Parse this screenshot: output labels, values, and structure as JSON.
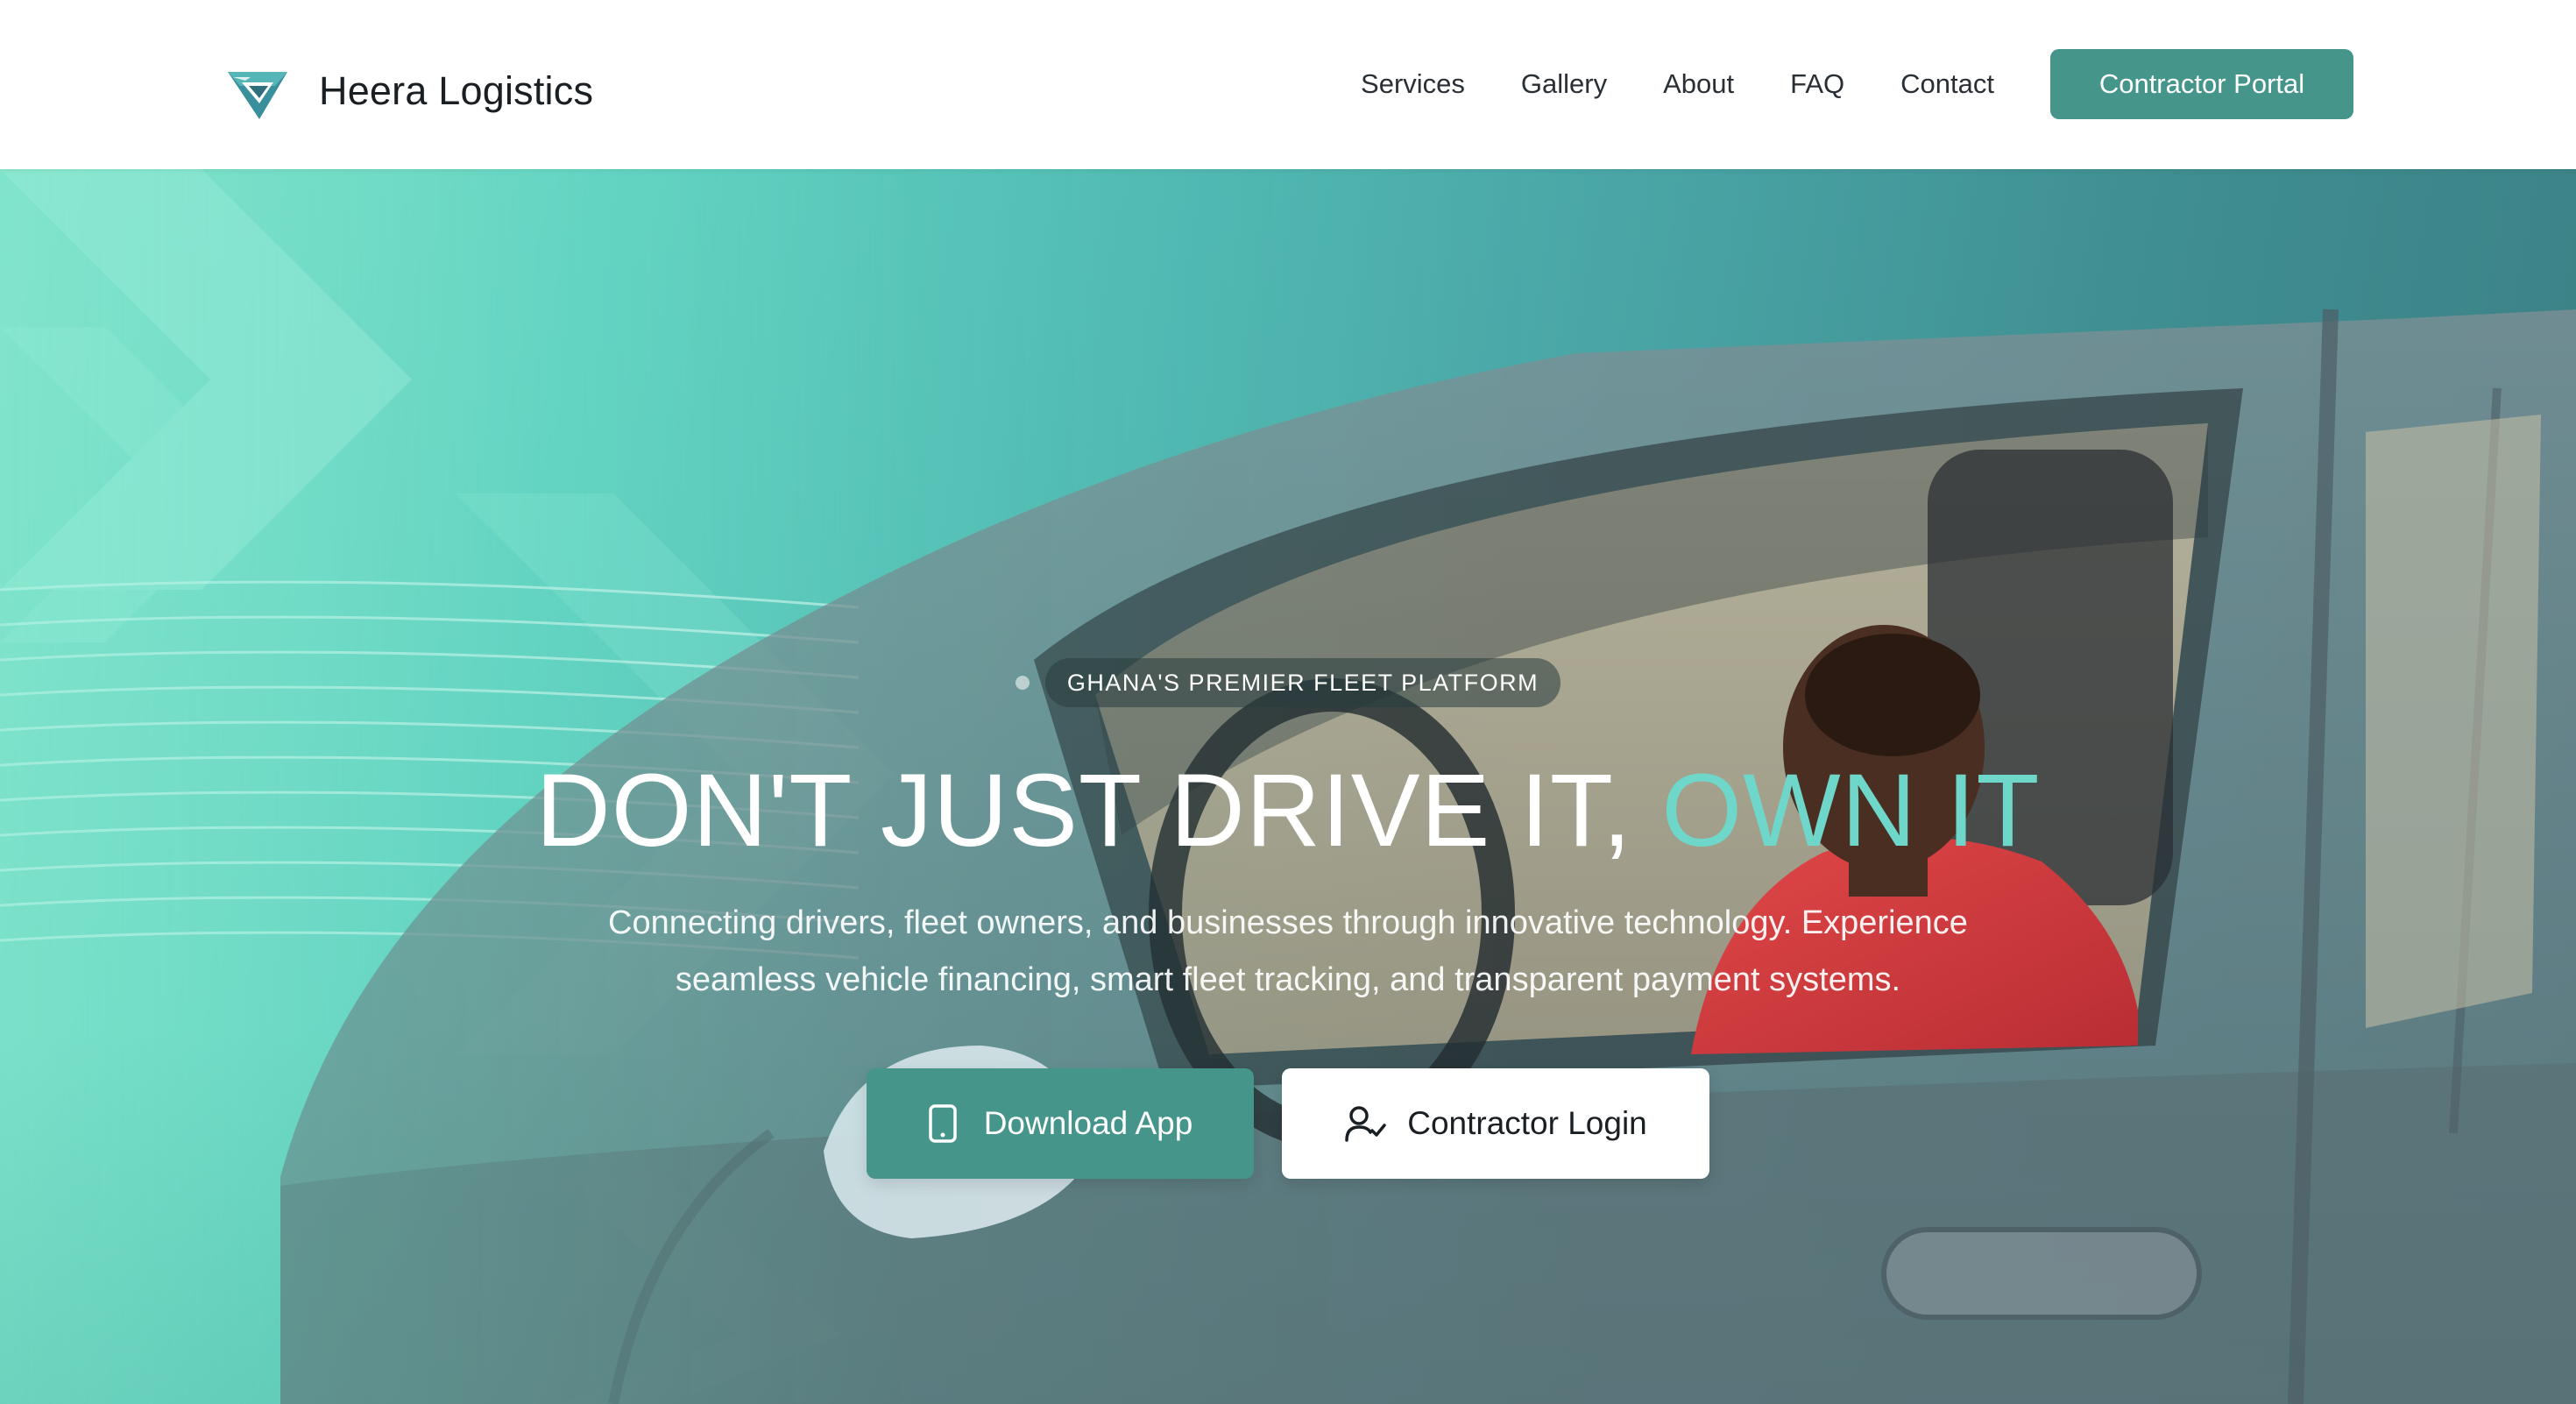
{
  "header": {
    "brand_name": "Heera Logistics",
    "logo_icon": "diamond-chevron-logo-icon",
    "nav": [
      {
        "label": "Services"
      },
      {
        "label": "Gallery"
      },
      {
        "label": "About"
      },
      {
        "label": "FAQ"
      },
      {
        "label": "Contact"
      }
    ],
    "portal_button": "Contractor Portal"
  },
  "hero": {
    "badge": "GHANA'S PREMIER FLEET PLATFORM",
    "headline_main": "DON'T JUST DRIVE IT, ",
    "headline_accent": "OWN IT",
    "subtitle": "Connecting drivers, fleet owners, and businesses through innovative technology. Experience seamless vehicle financing, smart fleet tracking, and transparent payment systems.",
    "primary_cta": {
      "label": "Download App",
      "icon": "smartphone-icon"
    },
    "secondary_cta": {
      "label": "Contractor Login",
      "icon": "user-check-icon"
    }
  },
  "colors": {
    "brand_primary": "#45958a",
    "accent_text": "#6fd7c9",
    "hero_gradient_start": "#8de8cf",
    "hero_gradient_end": "#3b7e84",
    "driver_shirt": "#d33a3a",
    "car_body": "#6e7b82"
  }
}
